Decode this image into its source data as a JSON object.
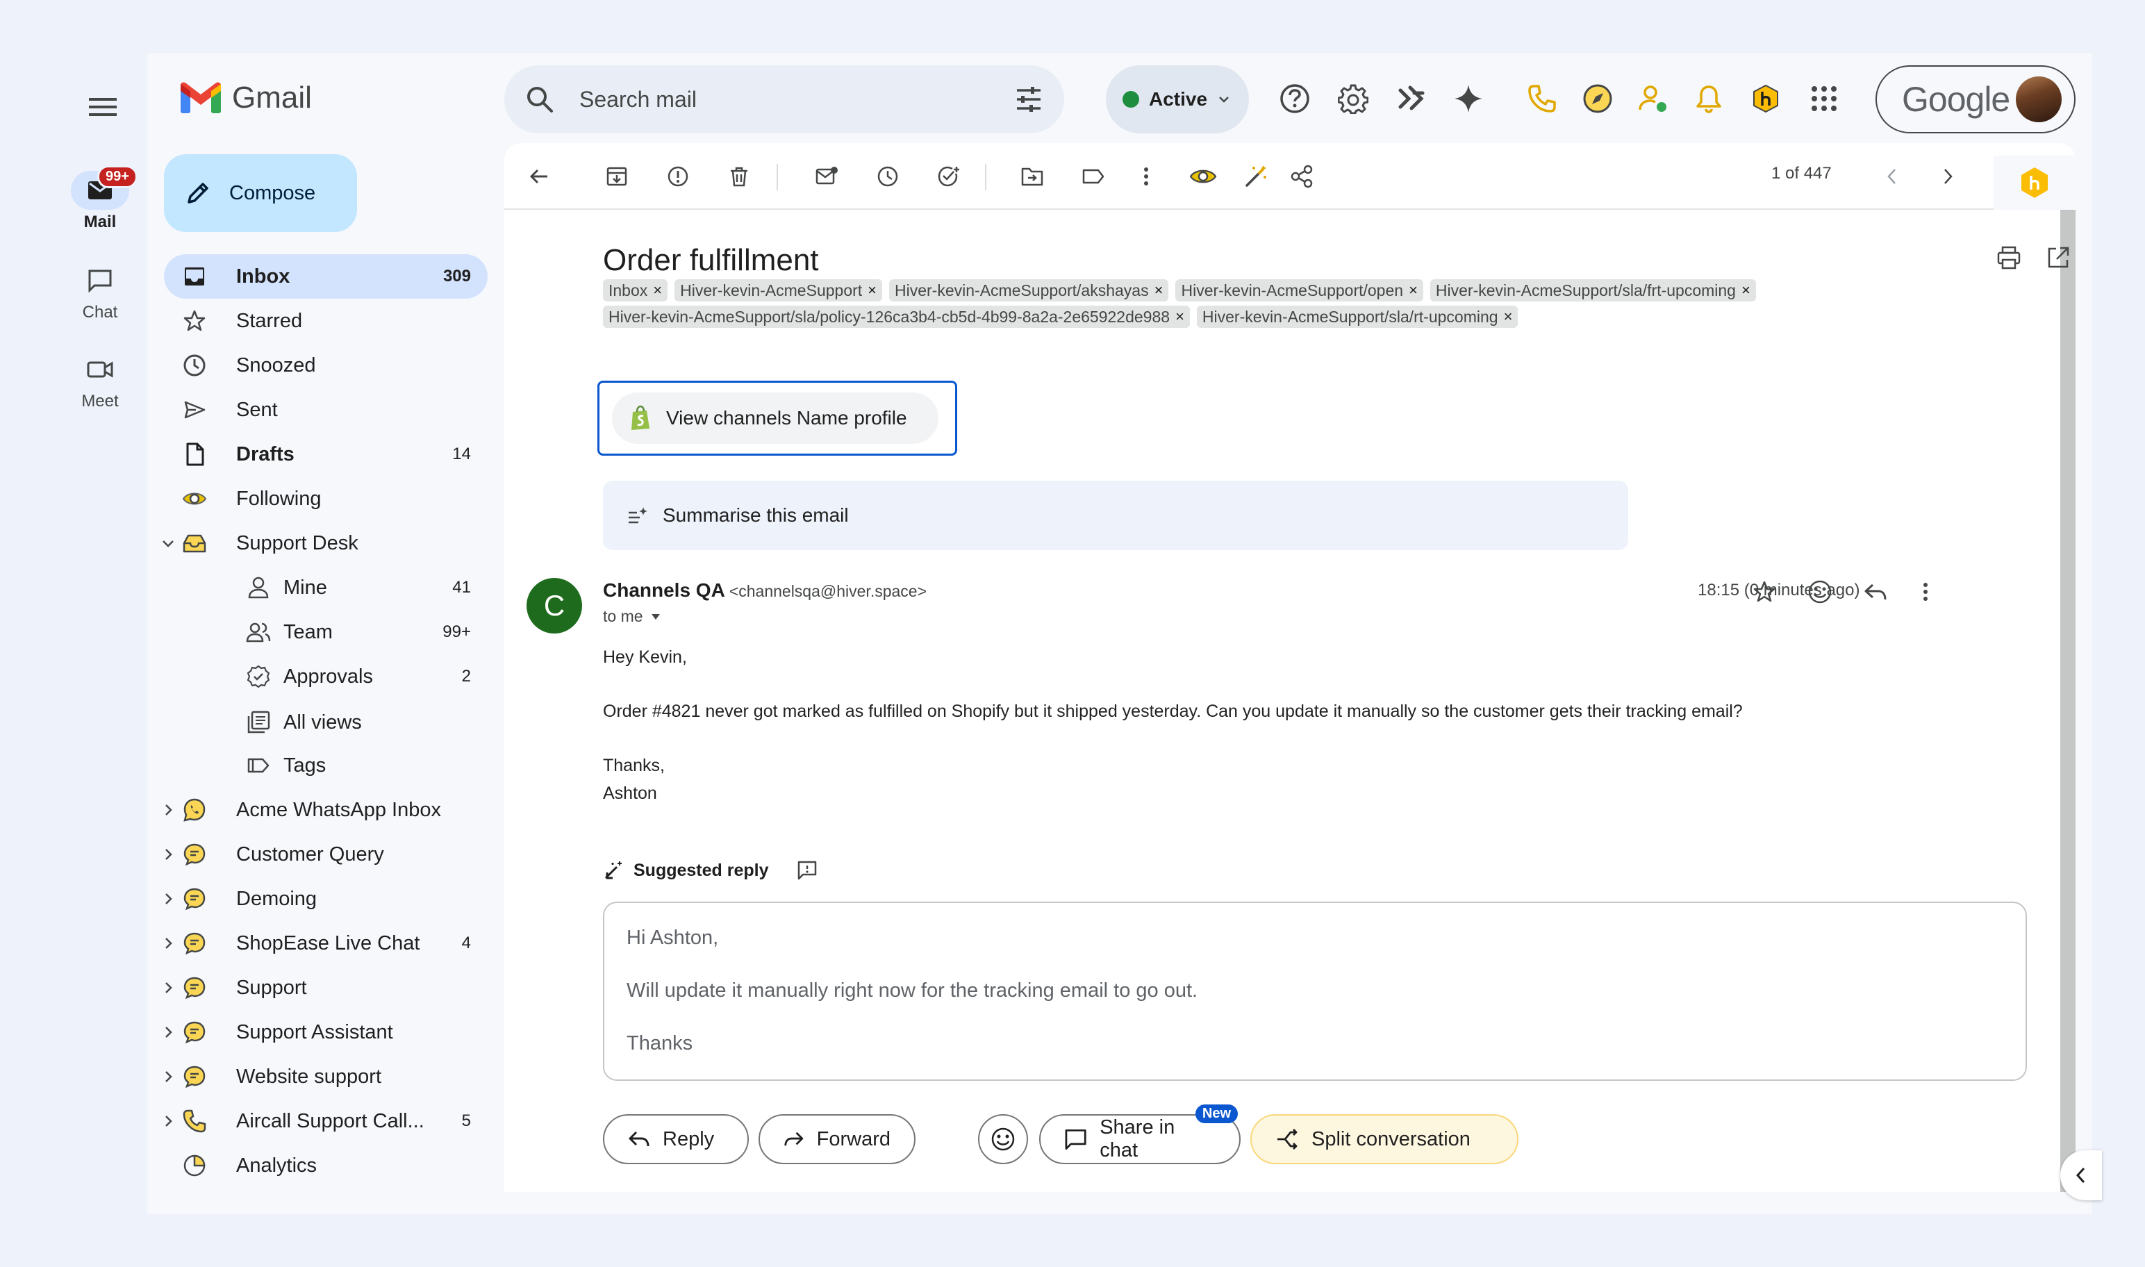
{
  "rail": {
    "items": [
      {
        "label": "Mail",
        "icon": "mail-icon",
        "badge": "99+"
      },
      {
        "label": "Chat",
        "icon": "chat-icon"
      },
      {
        "label": "Meet",
        "icon": "video-icon"
      }
    ]
  },
  "app": {
    "title": "Gmail"
  },
  "compose": {
    "label": "Compose"
  },
  "nav": {
    "items": [
      {
        "label": "Inbox",
        "count": "309"
      },
      {
        "label": "Starred",
        "count": ""
      },
      {
        "label": "Snoozed",
        "count": ""
      },
      {
        "label": "Sent",
        "count": ""
      },
      {
        "label": "Drafts",
        "count": "14"
      },
      {
        "label": "Following",
        "count": ""
      },
      {
        "label": "Support Desk",
        "count": ""
      },
      {
        "label": "Mine",
        "count": "41"
      },
      {
        "label": "Team",
        "count": "99+"
      },
      {
        "label": "Approvals",
        "count": "2"
      },
      {
        "label": "All views",
        "count": ""
      },
      {
        "label": "Tags",
        "count": ""
      },
      {
        "label": "Acme WhatsApp Inbox",
        "count": ""
      },
      {
        "label": "Customer Query",
        "count": ""
      },
      {
        "label": "Demoing",
        "count": ""
      },
      {
        "label": "ShopEase Live Chat",
        "count": "4"
      },
      {
        "label": "Support",
        "count": ""
      },
      {
        "label": "Support Assistant",
        "count": ""
      },
      {
        "label": "Website support",
        "count": ""
      },
      {
        "label": "Aircall Support Call...",
        "count": "5"
      },
      {
        "label": "Analytics",
        "count": ""
      }
    ]
  },
  "search": {
    "placeholder": "Search mail"
  },
  "status": {
    "label": "Active",
    "color": "#1e8e3e"
  },
  "account": {
    "brand": "Google"
  },
  "toolbar": {
    "pager": "1 of 447"
  },
  "email": {
    "subject": "Order fulfillment",
    "tags": [
      "Inbox",
      "Hiver-kevin-AcmeSupport",
      "Hiver-kevin-AcmeSupport/akshayas",
      "Hiver-kevin-AcmeSupport/open",
      "Hiver-kevin-AcmeSupport/sla/frt-upcoming",
      "Hiver-kevin-AcmeSupport/sla/policy-126ca3b4-cb5d-4b99-8a2a-2e65922de988",
      "Hiver-kevin-AcmeSupport/sla/rt-upcoming"
    ],
    "tag_close": "×",
    "profile_button": "View channels Name profile",
    "summarise": "Summarise this email",
    "sender_initial": "C",
    "sender_name": "Channels QA",
    "sender_email": "<channelsqa@hiver.space>",
    "to": "to me",
    "time": "18:15 (0 minutes ago)",
    "body": {
      "greeting": "Hey Kevin,",
      "line1": "Order #4821 never got marked as fulfilled on Shopify but it shipped yesterday. Can you update it manually so the customer gets their tracking email?",
      "signoff": "Thanks,",
      "name": "Ashton"
    }
  },
  "suggested": {
    "title": "Suggested reply",
    "lines": [
      "Hi Ashton,",
      "Will update it manually right now for the tracking email to go out.",
      "Thanks"
    ]
  },
  "actions": {
    "reply": "Reply",
    "forward": "Forward",
    "share": "Share in chat",
    "share_badge": "New",
    "split": "Split conversation"
  }
}
